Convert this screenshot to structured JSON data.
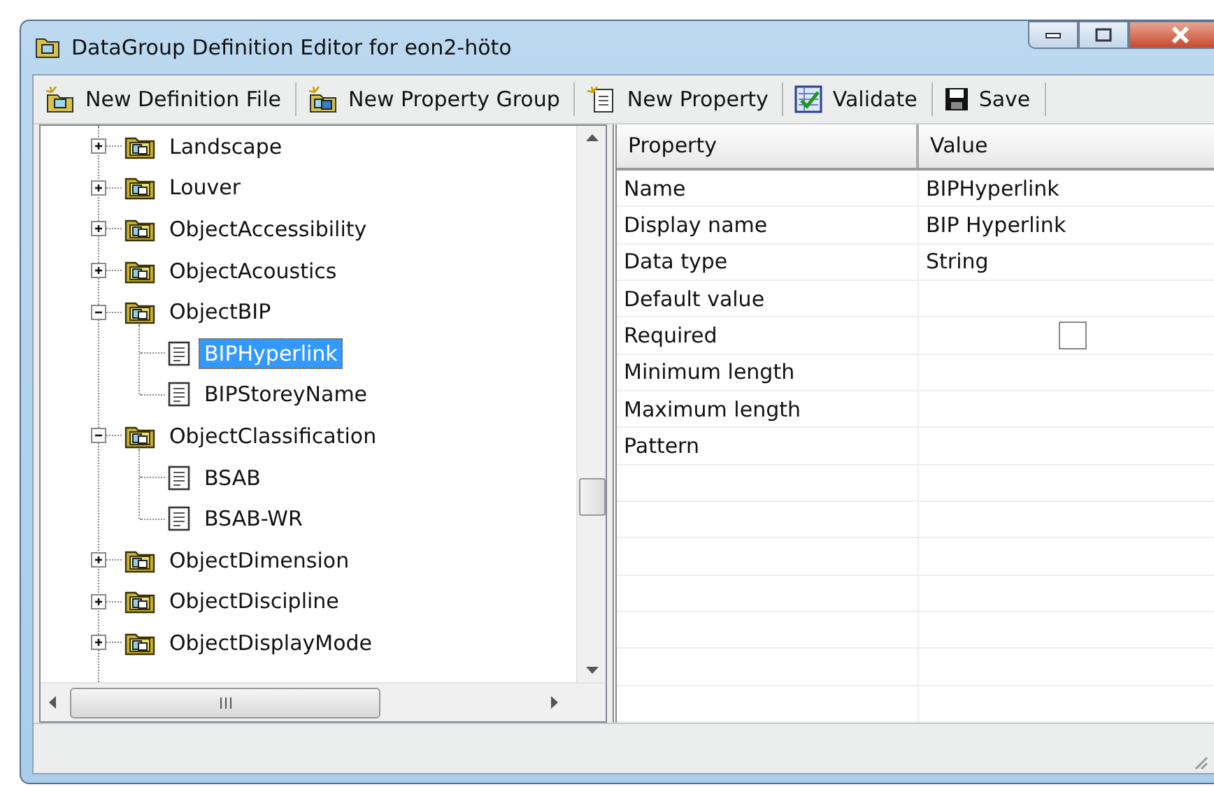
{
  "window": {
    "title": "DataGroup Definition Editor for eon2-höto"
  },
  "toolbar": [
    {
      "label": "New Definition File",
      "kind": "new-file"
    },
    {
      "label": "New Property Group",
      "kind": "new-group"
    },
    {
      "label": "New Property",
      "kind": "new-property"
    },
    {
      "label": "Validate",
      "kind": "validate"
    },
    {
      "label": "Save",
      "kind": "save"
    }
  ],
  "tree": [
    {
      "label": "Landscape",
      "expanded": false,
      "selected": false
    },
    {
      "label": "Louver",
      "expanded": false,
      "selected": false
    },
    {
      "label": "ObjectAccessibility",
      "expanded": false,
      "selected": false
    },
    {
      "label": "ObjectAcoustics",
      "expanded": false,
      "selected": false
    },
    {
      "label": "ObjectBIP",
      "expanded": true,
      "selected": false,
      "children": [
        {
          "label": "BIPHyperlink",
          "selected": true
        },
        {
          "label": "BIPStoreyName",
          "selected": false
        }
      ]
    },
    {
      "label": "ObjectClassification",
      "expanded": true,
      "selected": false,
      "children": [
        {
          "label": "BSAB",
          "selected": false
        },
        {
          "label": "BSAB-WR",
          "selected": false
        }
      ]
    },
    {
      "label": "ObjectDimension",
      "expanded": false,
      "selected": false
    },
    {
      "label": "ObjectDiscipline",
      "expanded": false,
      "selected": false
    },
    {
      "label": "ObjectDisplayMode",
      "expanded": false,
      "selected": false
    }
  ],
  "grid": {
    "columns": [
      "Property",
      "Value"
    ],
    "rows": [
      {
        "property": "Name",
        "kind": "text",
        "value": "BIPHyperlink"
      },
      {
        "property": "Display name",
        "kind": "text",
        "value": "BIP Hyperlink"
      },
      {
        "property": "Data type",
        "kind": "text",
        "value": "String"
      },
      {
        "property": "Default value",
        "kind": "text"
      },
      {
        "property": "Required",
        "kind": "checkbox",
        "checked": false
      },
      {
        "property": "Minimum length",
        "kind": "text"
      },
      {
        "property": "Maximum length",
        "kind": "text"
      },
      {
        "property": "Pattern",
        "kind": "text"
      }
    ]
  }
}
